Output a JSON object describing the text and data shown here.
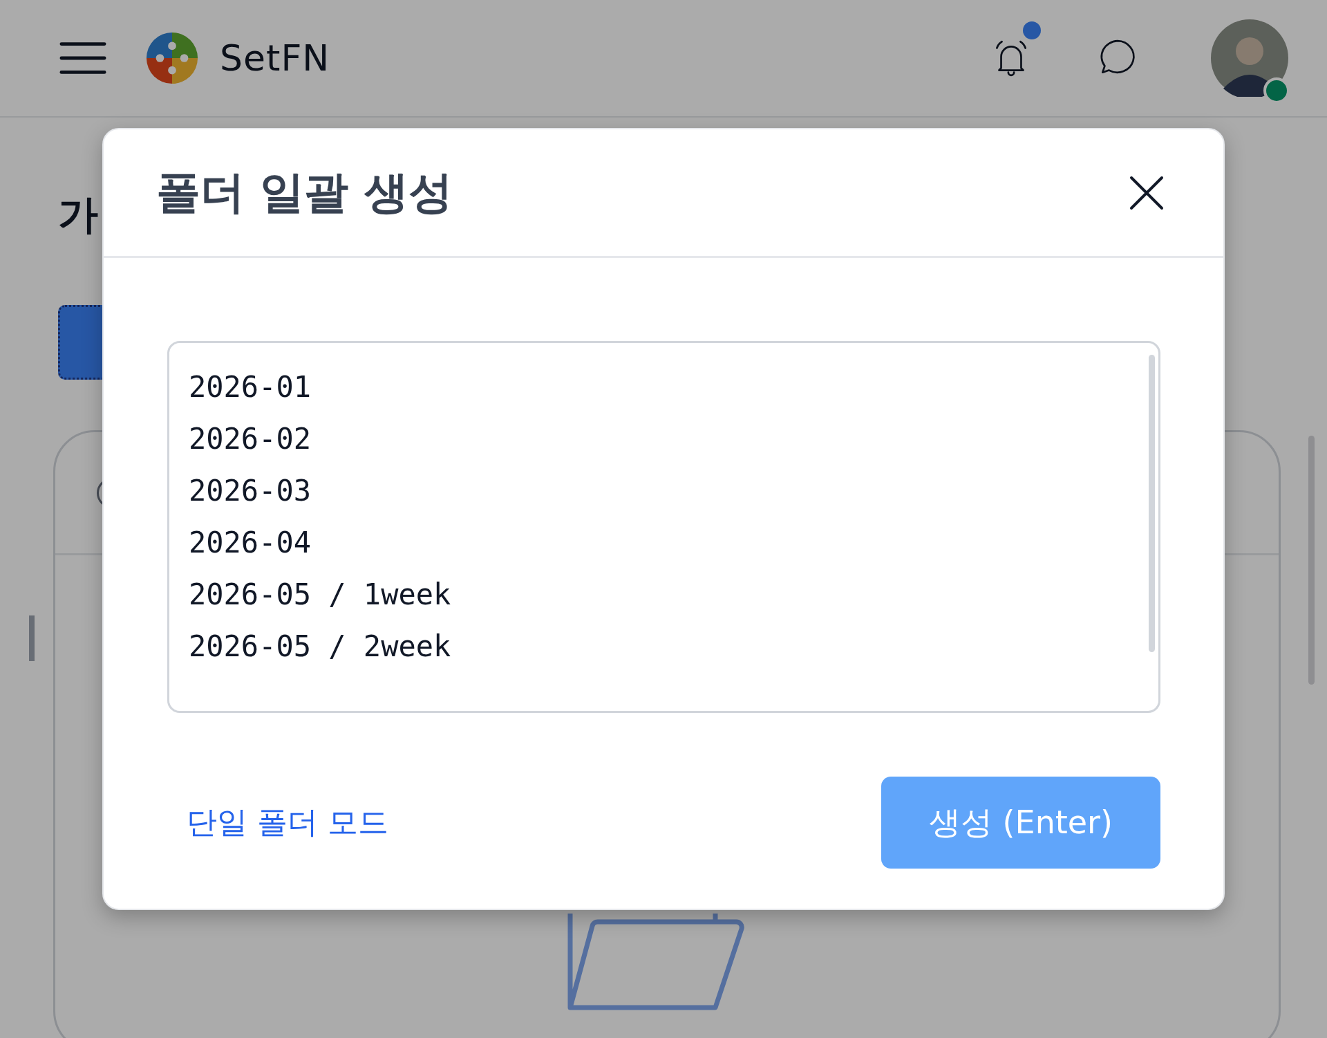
{
  "header": {
    "logo_text": "SetFN",
    "notifications": {
      "unread": true
    },
    "avatar": {
      "online": true
    }
  },
  "page": {
    "heading": "가"
  },
  "dialog": {
    "title": "폴더 일괄 생성",
    "lines": [
      "2026-01",
      "2026-02",
      "2026-03",
      "2026-04",
      "2026-05 / 1week",
      "2026-05 / 2week"
    ],
    "mode_link": "단일 폴더 모드",
    "submit": "생성 (Enter)"
  }
}
